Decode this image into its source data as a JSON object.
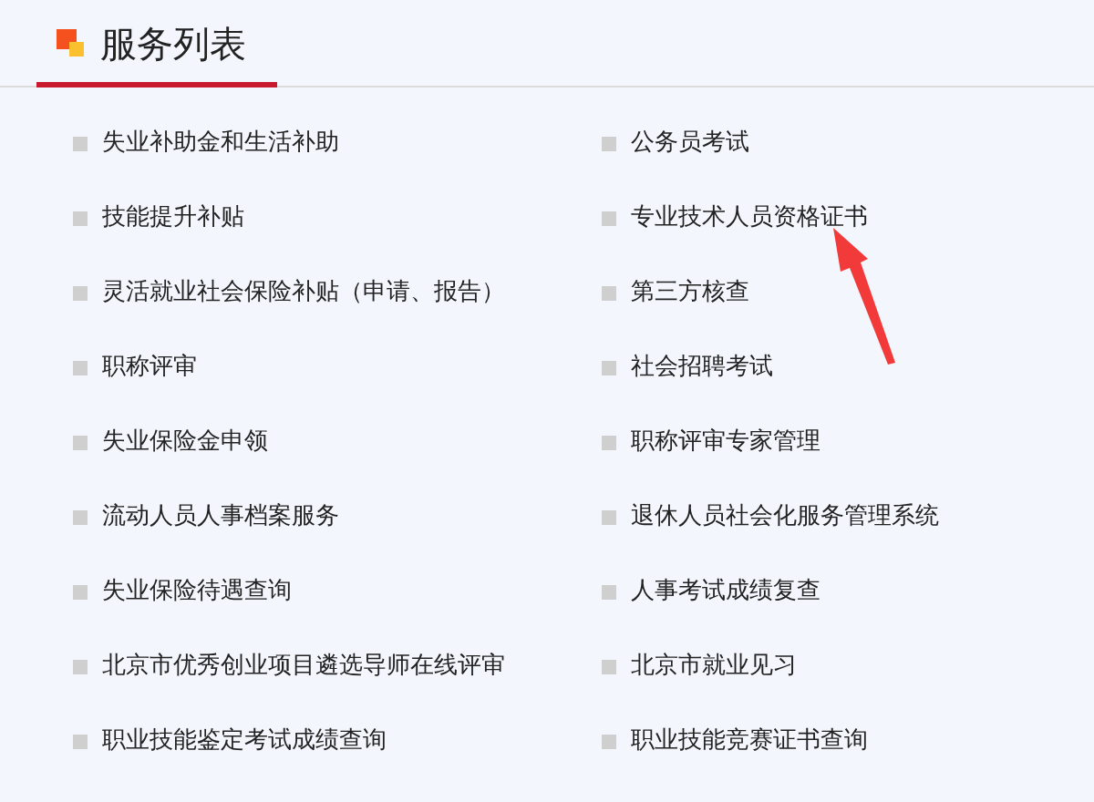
{
  "header": {
    "title": "服务列表"
  },
  "services": [
    {
      "label": "失业补助金和生活补助"
    },
    {
      "label": "公务员考试"
    },
    {
      "label": "技能提升补贴"
    },
    {
      "label": "专业技术人员资格证书"
    },
    {
      "label": "灵活就业社会保险补贴（申请、报告）"
    },
    {
      "label": "第三方核查"
    },
    {
      "label": "职称评审"
    },
    {
      "label": "社会招聘考试"
    },
    {
      "label": "失业保险金申领"
    },
    {
      "label": "职称评审专家管理"
    },
    {
      "label": "流动人员人事档案服务"
    },
    {
      "label": "退休人员社会化服务管理系统"
    },
    {
      "label": "失业保险待遇查询"
    },
    {
      "label": "人事考试成绩复查"
    },
    {
      "label": "北京市优秀创业项目遴选导师在线评审"
    },
    {
      "label": "北京市就业见习"
    },
    {
      "label": "职业技能鉴定考试成绩查询"
    },
    {
      "label": "职业技能竞赛证书查询"
    }
  ]
}
